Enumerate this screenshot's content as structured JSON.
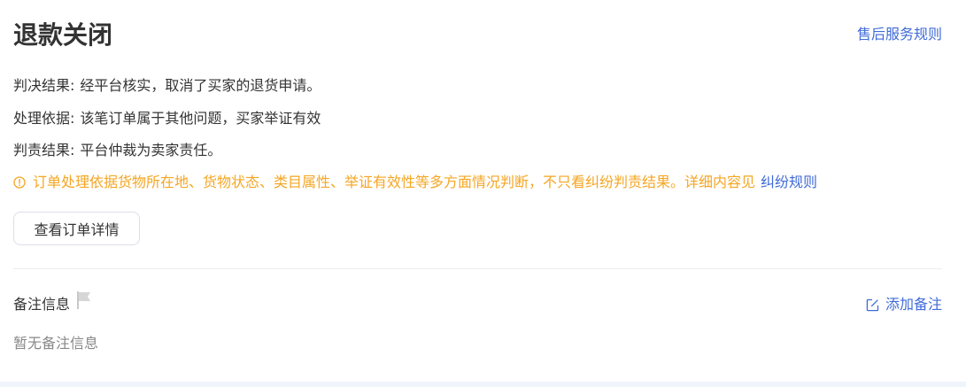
{
  "header": {
    "title": "退款关闭",
    "rules_link": "售后服务规则"
  },
  "details": {
    "judgment_label": "判决结果:",
    "judgment_value": "经平台核实，取消了买家的退货申请。",
    "basis_label": "处理依据:",
    "basis_value": "该笔订单属于其他问题，买家举证有效",
    "responsibility_label": "判责结果:",
    "responsibility_value": "平台仲裁为卖家责任。"
  },
  "notice": {
    "icon": "warning-circle-icon",
    "text": "订单处理依据货物所在地、货物状态、类目属性、举证有效性等多方面情况判断，不只看纠纷判责结果。详细内容见",
    "link": "纠纷规则",
    "color": "#f5a623"
  },
  "actions": {
    "view_order_label": "查看订单详情"
  },
  "notes": {
    "title": "备注信息",
    "flag_icon": "flag-icon",
    "add_label": "添加备注",
    "add_icon": "edit-icon",
    "empty_text": "暂无备注信息"
  },
  "colors": {
    "link": "#3f6ad8",
    "text": "#333333",
    "muted": "#888888"
  }
}
